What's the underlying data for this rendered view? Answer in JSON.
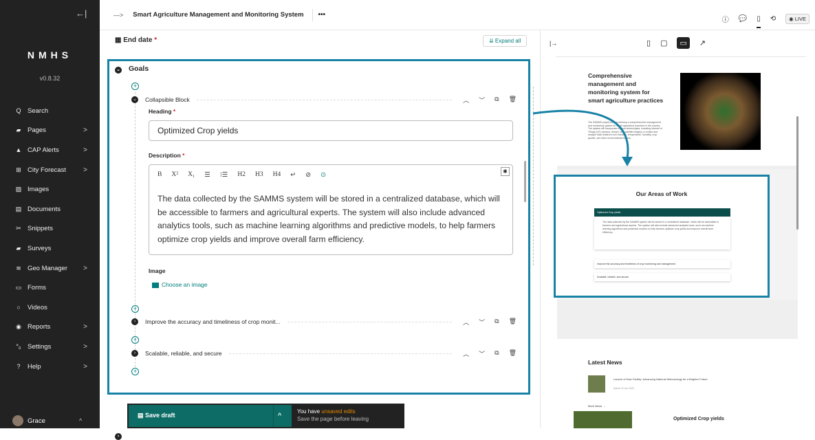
{
  "sidebar": {
    "collapse_icon": "←|",
    "brand": "NMHS",
    "version": "v0.8.32",
    "items": [
      {
        "label": "Search",
        "icon": "search-icon",
        "glyph": "Q",
        "chev": ""
      },
      {
        "label": "Pages",
        "icon": "folder-icon",
        "glyph": "▰",
        "chev": ">"
      },
      {
        "label": "CAP Alerts",
        "icon": "warning-icon",
        "glyph": "▲",
        "chev": ">"
      },
      {
        "label": "City Forecast",
        "icon": "table-icon",
        "glyph": "⊞",
        "chev": ">"
      },
      {
        "label": "Images",
        "icon": "image-icon",
        "glyph": "▨",
        "chev": ""
      },
      {
        "label": "Documents",
        "icon": "document-icon",
        "glyph": "▤",
        "chev": ""
      },
      {
        "label": "Snippets",
        "icon": "snippet-icon",
        "glyph": "✂",
        "chev": ""
      },
      {
        "label": "Surveys",
        "icon": "folder-icon",
        "glyph": "▰",
        "chev": ""
      },
      {
        "label": "Geo Manager",
        "icon": "layers-icon",
        "glyph": "≋",
        "chev": ">"
      },
      {
        "label": "Forms",
        "icon": "form-icon",
        "glyph": "▭",
        "chev": ""
      },
      {
        "label": "Videos",
        "icon": "video-icon",
        "glyph": "○",
        "chev": ""
      },
      {
        "label": "Reports",
        "icon": "reports-icon",
        "glyph": "◉",
        "chev": ">"
      },
      {
        "label": "Settings",
        "icon": "settings-icon",
        "glyph": "°₀",
        "chev": ">"
      },
      {
        "label": "Help",
        "icon": "help-icon",
        "glyph": "?",
        "chev": ">"
      }
    ],
    "user": {
      "name": "Grace",
      "chev": "^"
    }
  },
  "topbar": {
    "toggle": "—>",
    "title": "Smart Agriculture Management and Monitoring System",
    "more": "•••",
    "live": "◉ LIVE"
  },
  "editor": {
    "end_date_label": "End date",
    "required_mark": "*",
    "expand_all": "⇊ Expand all",
    "goals_label": "Goals",
    "block1": {
      "title": "Collapsible Block",
      "heading_label": "Heading",
      "heading_value": "Optimized Crop yields",
      "description_label": "Description",
      "description_text": "The data collected by the SAMMS system will be stored in a centralized database, which will be accessible to farmers and agricultural experts. The system will also include advanced analytics tools, such as machine learning algorithms and predictive models, to help farmers optimize crop yields and improve overall farm efficiency.",
      "image_label": "Image",
      "choose_image": "Choose an image"
    },
    "block2_title": "Improve the accuracy and timeliness of crop monit...",
    "block3_title": "Scalable, reliable, and secure",
    "toolbar": [
      "B",
      "X²",
      "X₁",
      "☰",
      "⁝☰",
      "H2",
      "H3",
      "H4",
      "↵",
      "⊘",
      "⊙"
    ],
    "pin_icon": "✱"
  },
  "savebar": {
    "save_label": "Save draft",
    "msg_prefix": "You have ",
    "msg_highlight": "unsaved edits",
    "msg_sub": "Save the page before leaving"
  },
  "preview": {
    "arrow": "|→",
    "hero_title": "Comprehensive management and monitoring system for smart agriculture practices",
    "hero_paragraph": "The SAMMS project aims to develop a comprehensive management and monitoring system for smart agriculture practices in the country. The system will incorporate various technologies, including Internet of Things (IoT) sensors, drones, and satellite imagery, to collect and analyze data related to soil moisture, temperature, humidity, crop growth, and other environmental factors.",
    "areas_title": "Our Areas of Work",
    "acc1_title": "Optimized Crop yields",
    "acc1_body": "The data collected by the SAMMS system will be stored in a centralized database, which will be accessible to farmers and agricultural experts. The system will also include advanced analytics tools, such as machine learning algorithms and predictive models, to help farmers optimize crop yields and improve overall farm efficiency.",
    "acc2_title": "Improve the accuracy and timeliness of crop monitoring and management",
    "acc3_title": "Scalable, reliable, and secure",
    "news_title": "Latest News",
    "news_item": "Launch of New Facility: Advancing National Meteorology for a Brighter Future",
    "news_meta": "Article    19 Jun 2023",
    "more_news": "More News →",
    "bottom_title": "Optimized Crop yields"
  },
  "colors": {
    "accent": "#1782a6",
    "teal": "#007d7c",
    "save": "#0d6d66",
    "warning": "#e58a00"
  }
}
